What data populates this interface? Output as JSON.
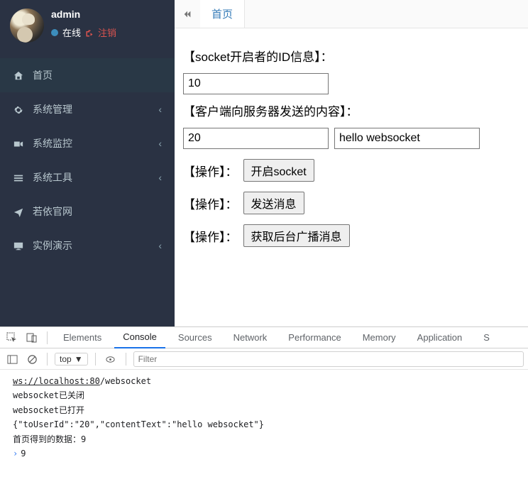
{
  "user": {
    "name": "admin",
    "online_text": "在线",
    "logout_text": "注销"
  },
  "nav": {
    "items": [
      {
        "icon": "home",
        "label": "首页"
      },
      {
        "icon": "gear",
        "label": "系统管理"
      },
      {
        "icon": "video",
        "label": "系统监控"
      },
      {
        "icon": "bars",
        "label": "系统工具"
      },
      {
        "icon": "plane",
        "label": "若依官网"
      },
      {
        "icon": "screen",
        "label": "实例演示"
      }
    ]
  },
  "tabs": {
    "home": "首页"
  },
  "page": {
    "label_id_info": "【socket开启者的ID信息】：",
    "input_opener_id": "10",
    "label_client_send": "【客户端向服务器发送的内容】：",
    "input_target_id": "20",
    "input_message": "hello websocket",
    "op_label": "【操作】：",
    "btn_open_socket": "开启socket",
    "btn_send": "发送消息",
    "btn_broadcast": "获取后台广播消息"
  },
  "devtools": {
    "tabs": {
      "elements": "Elements",
      "console": "Console",
      "sources": "Sources",
      "network": "Network",
      "performance": "Performance",
      "memory": "Memory",
      "application": "Application",
      "more": "S"
    },
    "context_select": "top",
    "filter_placeholder": "Filter",
    "console_lines": [
      {
        "scheme": "ws://localhost:80",
        "suffix": "/websocket"
      },
      {
        "text": "websocket已关闭"
      },
      {
        "text": "websocket已打开"
      },
      {
        "text": "{\"toUserId\":\"20\",\"contentText\":\"hello websocket\"}"
      },
      {
        "text": "首页得到的数据：9"
      },
      {
        "prompt": true,
        "text": "9"
      }
    ]
  }
}
